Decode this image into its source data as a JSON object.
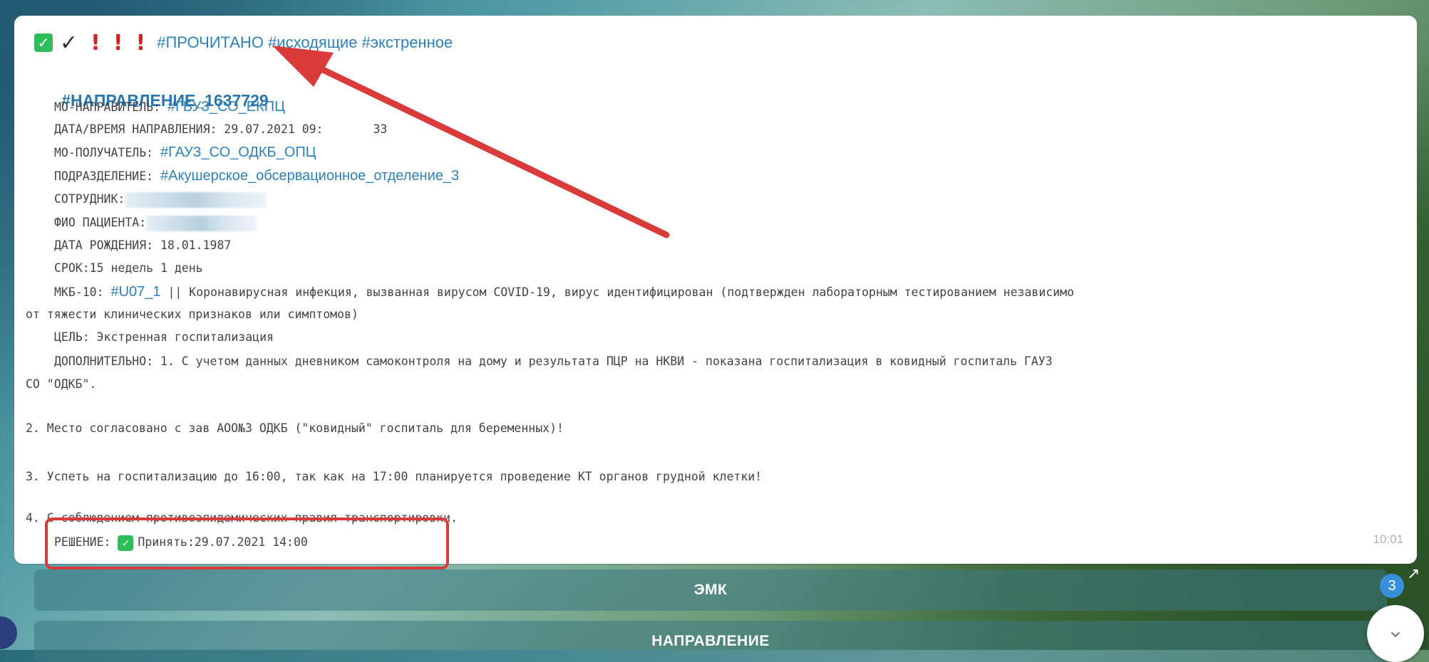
{
  "header": {
    "check_icon": "✓",
    "checkmark_icon": "✓",
    "exclam": "!",
    "tags": "#ПРОЧИТАНО #исходящие #экстренное"
  },
  "message": {
    "direction_tag": "#НАПРАВЛЕНИЕ_1637729",
    "mo_sender_label": "МО-НАПРАВИТЕЛЬ: ",
    "mo_sender_value": "#ГБУЗ_СО_ЕКПЦ",
    "date_label": "ДАТА/ВРЕМЯ НАПРАВЛЕНИЯ: ",
    "date_value": "29.07.2021 09:",
    "date_tail": "33",
    "mo_receiver_label": "МО-ПОЛУЧАТЕЛЬ: ",
    "mo_receiver_value": "#ГАУЗ_СО_ОДКБ_ОПЦ",
    "division_label": "ПОДРАЗДЕЛЕНИЕ: ",
    "division_value": "#Акушерское_обсервационное_отделение_3",
    "employee_label": "СОТРУДНИК:",
    "patient_label": "ФИО ПАЦИЕНТА:",
    "birth_label": "ДАТА РОЖДЕНИЯ: 18.01.1987",
    "term_label": "СРОК:15 недель 1 день",
    "mkb_label": "МКБ-10: ",
    "mkb_code": "#U07_1",
    "mkb_text": " || Коронавирусная инфекция, вызванная вирусом COVID-19, вирус идентифицирован (подтвержден лабораторным тестированием независимо",
    "mkb_text2": "от тяжести клинических признаков или симптомов)",
    "goal": "ЦЕЛЬ: Экстренная госпитализация",
    "extra1": "ДОПОЛНИТЕЛЬНО: 1. С учетом данных дневником самоконтроля на дому и результата ПЦР на НКВИ - показана госпитализация в ковидный госпиталь ГАУЗ",
    "extra1b": "СО \"ОДКБ\".",
    "extra2": "2. Место согласовано с зав АОО№3 ОДКБ (\"ковидный\" госпиталь для беременных)!",
    "extra3": "3. Успеть на госпитализацию до 16:00, так как на 17:00 планируется проведение КТ органов грудной клетки!",
    "extra4": "4. С соблюдением противоэпидемических правил транспортировки.",
    "decision_label": "РЕШЕНИЕ: ",
    "decision_value": "Принять:29.07.2021 14:00",
    "time": "10:01"
  },
  "keyboard": {
    "btn1": "ЭМК",
    "btn2": "НАПРАВЛЕНИЕ"
  },
  "scroll": {
    "badge": "3",
    "chevron": "⌄"
  },
  "colors": {
    "link": "#2f7fb8",
    "annotation": "#d93a3a",
    "check": "#2ebd59"
  }
}
